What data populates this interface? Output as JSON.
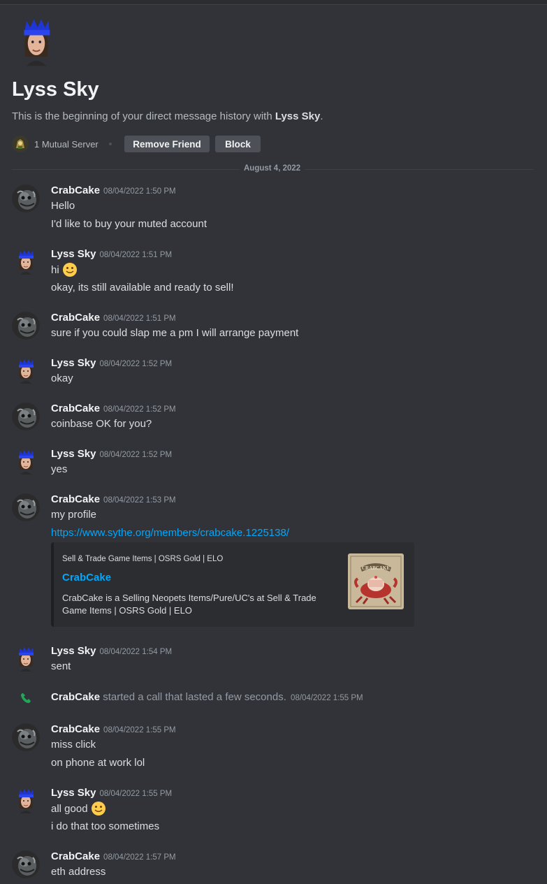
{
  "header": {
    "name": "Lyss Sky",
    "desc_prefix": "This is the beginning of your direct message history with ",
    "desc_name": "Lyss Sky",
    "desc_suffix": ".",
    "mutual_label": "1 Mutual Server",
    "remove_friend_label": "Remove Friend",
    "block_label": "Block"
  },
  "divider_date": "August 4, 2022",
  "messages": [
    {
      "author": "CrabCake",
      "ts": "08/04/2022 1:50 PM",
      "lines": [
        "Hello",
        "I'd like to buy your muted account"
      ]
    },
    {
      "author": "Lyss Sky",
      "ts": "08/04/2022 1:51 PM",
      "lines": [
        "hi",
        "okay, its still available and ready to sell!"
      ]
    },
    {
      "author": "CrabCake",
      "ts": "08/04/2022 1:51 PM",
      "lines": [
        "sure if you could slap me a pm I will arrange payment"
      ]
    },
    {
      "author": "Lyss Sky",
      "ts": "08/04/2022 1:52 PM",
      "lines": [
        "okay"
      ]
    },
    {
      "author": "CrabCake",
      "ts": "08/04/2022 1:52 PM",
      "lines": [
        "coinbase OK for you?"
      ]
    },
    {
      "author": "Lyss Sky",
      "ts": "08/04/2022 1:52 PM",
      "lines": [
        "yes"
      ]
    },
    {
      "author": "CrabCake",
      "ts": "08/04/2022 1:53 PM",
      "lines": [
        "my profile",
        "https://www.sythe.org/members/crabcake.1225138/"
      ]
    },
    {
      "author": "Lyss Sky",
      "ts": "08/04/2022 1:54 PM",
      "lines": [
        "sent"
      ]
    },
    {
      "author": "CrabCake",
      "ts": "08/04/2022 1:55 PM",
      "lines": [
        "miss click",
        "on phone at work lol"
      ]
    },
    {
      "author": "Lyss Sky",
      "ts": "08/04/2022 1:55 PM",
      "lines": [
        "all good",
        "i do that too sometimes"
      ]
    },
    {
      "author": "CrabCake",
      "ts": "08/04/2022 1:57 PM",
      "lines": [
        "eth address"
      ]
    }
  ],
  "embed": {
    "provider": "Sell & Trade Game Items | OSRS Gold | ELO",
    "title": "CrabCake",
    "description": "CrabCake is a Selling Neopets Items/Pure/UC's at Sell & Trade Game Items | OSRS Gold | ELO",
    "thumb_text": "CRABCAKE"
  },
  "call": {
    "author": "CrabCake",
    "text": "started a call that lasted a few seconds.",
    "ts": "08/04/2022 1:55 PM"
  },
  "colors": {
    "background": "#313338",
    "link": "#00a8fc",
    "muted": "#949ba4",
    "call_green": "#23a55a"
  },
  "icons": [
    "lyss-avatar-icon",
    "crab-avatar-icon",
    "smile-emoji-icon",
    "phone-call-icon",
    "mutual-server-icon"
  ]
}
